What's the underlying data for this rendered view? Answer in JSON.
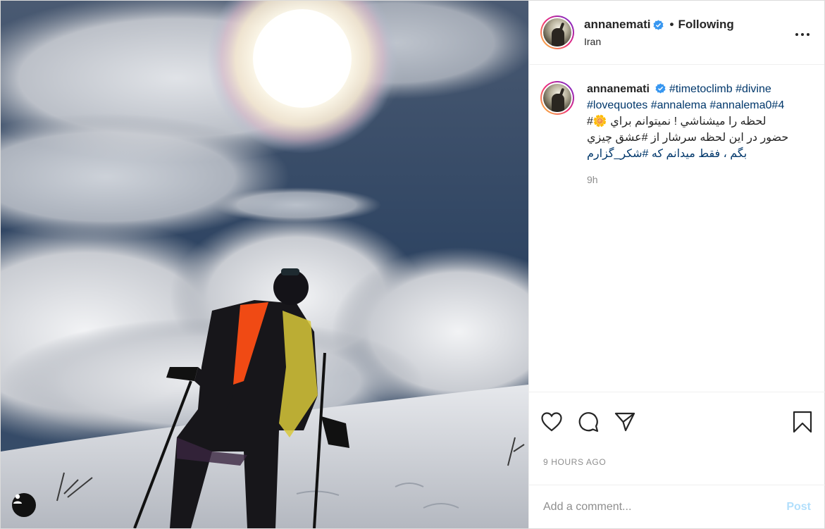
{
  "post": {
    "image_alt": "Hiker with ski poles looking up at a sun halo above clouds on a snowy mountain",
    "tag_icon": "user-tag-icon"
  },
  "header": {
    "username": "annanemati",
    "verified_icon": "verified-badge-icon",
    "separator": "•",
    "follow_status": "Following",
    "location": "Iran",
    "more_icon": "more-options-icon"
  },
  "caption": {
    "username": "annanemati",
    "hashtags_en": "#timetoclimb #divine #lovequotes #annalema #annalema0#4",
    "line1": "لحظه را ميشناشي ! نميتوانم براي 🌼#",
    "line2": "حضور در اين لحظه سرشار از #عشق چيزي",
    "line3": "بگم ، فقط ميدانم كه #شكر_گزارم",
    "age": "9h"
  },
  "actions": {
    "like_icon": "heart-icon",
    "comment_icon": "comment-icon",
    "share_icon": "share-icon",
    "save_icon": "bookmark-icon",
    "timestamp": "9 HOURS AGO"
  },
  "comment_box": {
    "placeholder": "Add a comment...",
    "post_label": "Post"
  },
  "colors": {
    "link": "#00376b",
    "verified": "#3897f0",
    "post_disabled": "#b2dffc"
  }
}
